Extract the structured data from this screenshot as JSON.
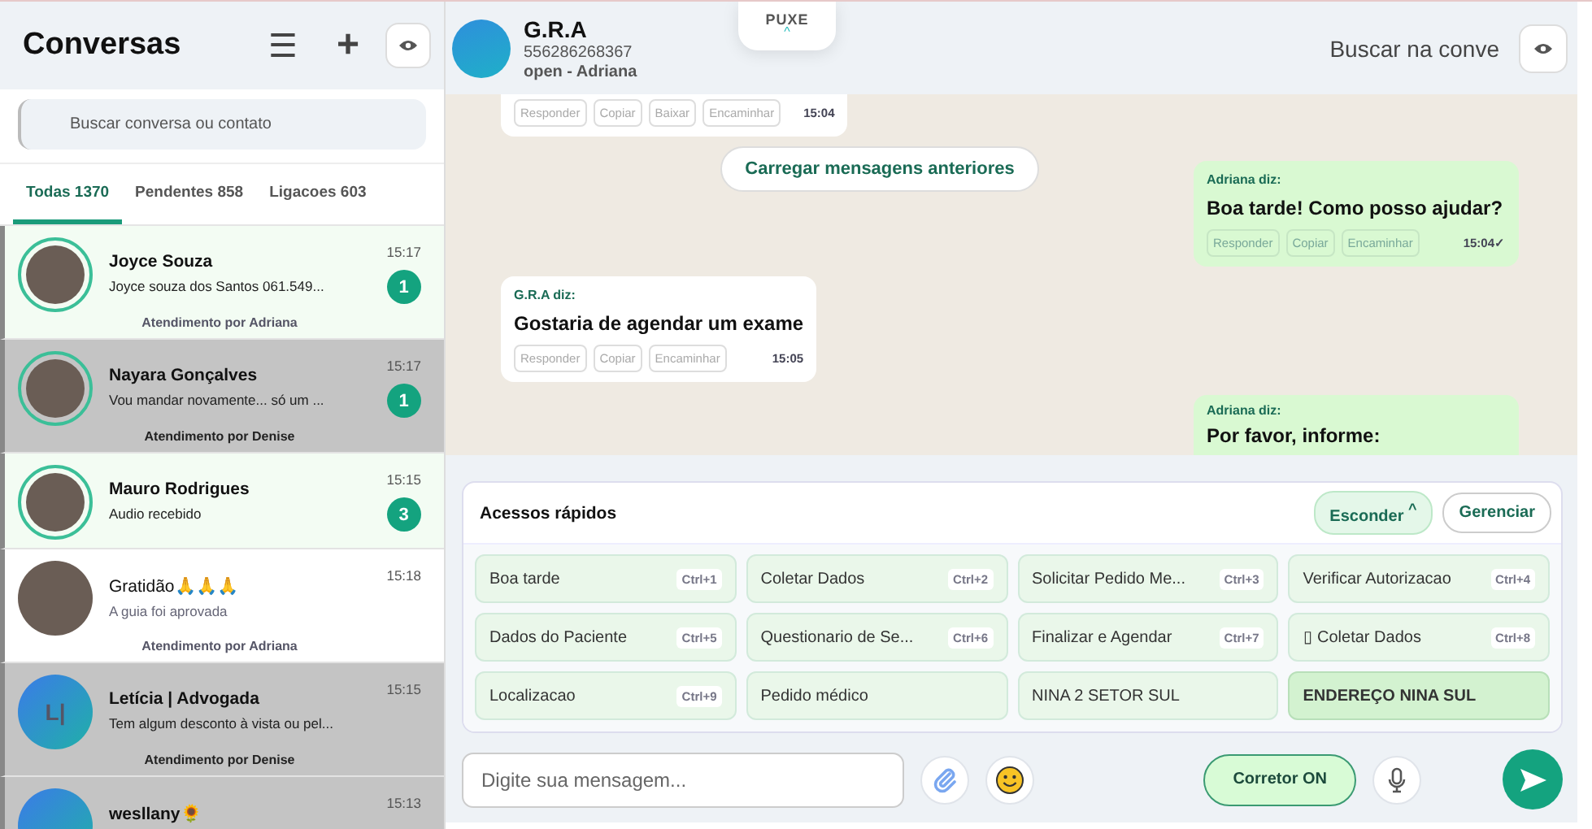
{
  "sidebar": {
    "title": "Conversas",
    "menu_glyph": "☰",
    "add_glyph": "+",
    "search": {
      "placeholder": "Buscar conversa ou contato"
    },
    "tabs": [
      {
        "label": "Todas 1370",
        "selected": true
      },
      {
        "label": "Pendentes 858",
        "selected": false
      },
      {
        "label": "Ligacoes 603",
        "selected": false
      }
    ],
    "conversations": [
      {
        "kind": "unread",
        "photo": true,
        "ring": true,
        "name": "Joyce Souza",
        "preview": "Joyce souza dos Santos 061.549...",
        "time": "15:17",
        "badge": "1",
        "attendant": "Atendimento por Adriana"
      },
      {
        "kind": "assigned",
        "photo": true,
        "ring": true,
        "name": "Nayara Gonçalves",
        "preview": "Vou mandar novamente... só um ...",
        "time": "15:17",
        "badge": "1",
        "attendant": "Atendimento por Denise"
      },
      {
        "kind": "unread",
        "photo": true,
        "ring": true,
        "name": "Mauro Rodrigues",
        "preview": "Audio recebido",
        "time": "15:15",
        "badge": "3"
      },
      {
        "kind": "read",
        "photo": true,
        "ring": false,
        "name": "Gratidão🙏🙏🙏",
        "preview": "A guia foi aprovada",
        "time": "15:18",
        "attendant": "Atendimento por Adriana"
      },
      {
        "kind": "assigned",
        "photo": false,
        "initials": "L|",
        "ring": false,
        "name": "Letícia | Advogada",
        "preview": "Tem algum desconto à vista ou pel...",
        "time": "15:15",
        "attendant": "Atendimento por Denise"
      },
      {
        "kind": "assigned",
        "photo": false,
        "ring": false,
        "name": "wesllany🌻",
        "time": "15:13"
      }
    ]
  },
  "chat": {
    "contact": {
      "name": "G.R.A",
      "phone": "556286268367",
      "status": "open - Adriana"
    },
    "pull_tab": {
      "label": "PUXE",
      "caret": "^"
    },
    "search": {
      "placeholder": "Buscar na conve"
    },
    "load_more": "Carregar mensagens anteriores",
    "messages": [
      {
        "outgoing": false,
        "actions": [
          "Responder",
          "Copiar",
          "Baixar",
          "Encaminhar"
        ],
        "time": "15:04"
      },
      {
        "outgoing": true,
        "sender": "Adriana diz:",
        "text": "Boa tarde! Como posso ajudar?",
        "actions": [
          "Responder",
          "Copiar",
          "Encaminhar"
        ],
        "time": "15:04✓"
      },
      {
        "outgoing": false,
        "sender": "G.R.A diz:",
        "text": "Gostaria de agendar um exame",
        "actions": [
          "Responder",
          "Copiar",
          "Encaminhar"
        ],
        "time": "15:05"
      },
      {
        "outgoing": true,
        "sender": "Adriana diz:",
        "text": "Por favor, informe:"
      }
    ],
    "quick_access": {
      "title": "Acessos rápidos",
      "hide_button": "Esconder",
      "hide_caret": "^",
      "manage_button": "Gerenciar",
      "items": [
        {
          "label": "Boa tarde",
          "shortcut": "Ctrl+1",
          "selected": false
        },
        {
          "label": "Coletar Dados",
          "shortcut": "Ctrl+2",
          "selected": false
        },
        {
          "label": "Solicitar Pedido Me...",
          "shortcut": "Ctrl+3",
          "selected": false
        },
        {
          "label": "Verificar Autorizacao",
          "shortcut": "Ctrl+4",
          "selected": false
        },
        {
          "label": "Dados do Paciente",
          "shortcut": "Ctrl+5",
          "selected": false
        },
        {
          "label": "Questionario de Se...",
          "shortcut": "Ctrl+6",
          "selected": false
        },
        {
          "label": "Finalizar e Agendar",
          "shortcut": "Ctrl+7",
          "selected": false
        },
        {
          "label": "▯ Coletar Dados",
          "shortcut": "Ctrl+8",
          "selected": false
        },
        {
          "label": "Localizacao",
          "shortcut": "Ctrl+9",
          "selected": false
        },
        {
          "label": "Pedido médico",
          "selected": false
        },
        {
          "label": "NINA 2 SETOR SUL",
          "selected": false
        },
        {
          "label": "ENDEREÇO NINA SUL",
          "selected": true
        }
      ]
    },
    "composer": {
      "placeholder": "Digite sua mensagem...",
      "corrector": {
        "label": "Corretor ON",
        "on": true
      }
    }
  }
}
